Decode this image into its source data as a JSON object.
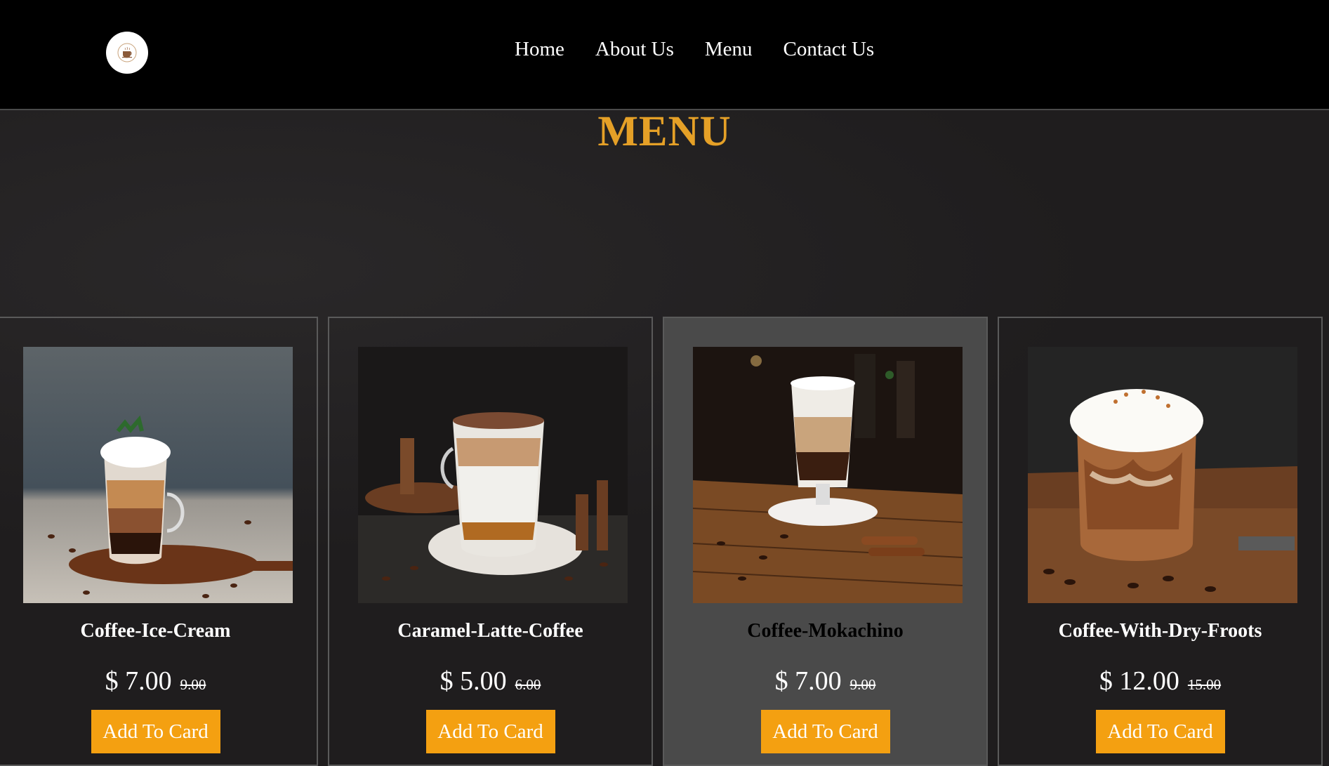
{
  "nav": {
    "items": [
      "Home",
      "About Us",
      "Menu",
      "Contact Us"
    ]
  },
  "page": {
    "title": "MENU"
  },
  "colors": {
    "accent": "#e5a027",
    "button": "#f4a011",
    "header_bg": "#000000",
    "page_bg": "#1f1d1e",
    "active_card_bg": "#4a4a4a"
  },
  "products": [
    {
      "name": "Coffee-Ice-Cream",
      "price": "$ 7.00",
      "old_price": "9.00",
      "button": "Add To Card",
      "image": "coffee-ice-cream-photo"
    },
    {
      "name": "Caramel-Latte-Coffee",
      "price": "$ 5.00",
      "old_price": "6.00",
      "button": "Add To Card",
      "image": "caramel-latte-photo"
    },
    {
      "name": "Coffee-Mokachino",
      "price": "$ 7.00",
      "old_price": "9.00",
      "button": "Add To Card",
      "image": "coffee-mokachino-photo"
    },
    {
      "name": "Coffee-With-Dry-Froots",
      "price": "$ 12.00",
      "old_price": "15.00",
      "button": "Add To Card",
      "image": "coffee-dry-froots-photo"
    }
  ]
}
